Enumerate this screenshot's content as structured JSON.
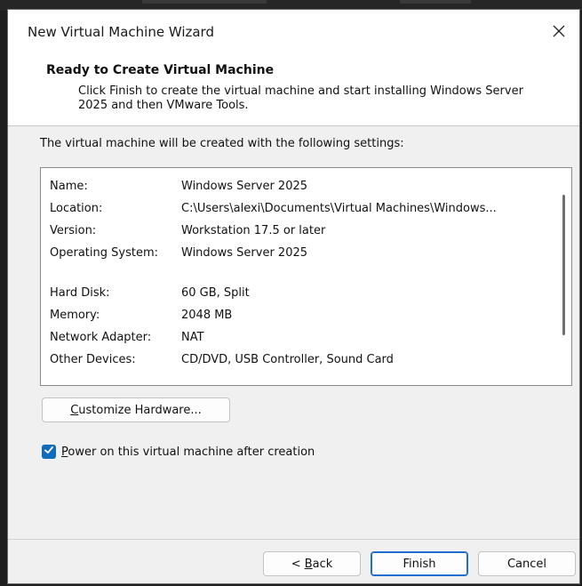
{
  "window": {
    "title": "New Virtual Machine Wizard"
  },
  "header": {
    "title": "Ready to Create Virtual Machine",
    "description": "Click Finish to create the virtual machine and start installing Windows Server 2025 and then VMware Tools."
  },
  "intro": "The virtual machine will be created with the following settings:",
  "settings": [
    {
      "key": "Name:",
      "value": "Windows Server 2025"
    },
    {
      "key": "Location:",
      "value": "C:\\Users\\alexi\\Documents\\Virtual Machines\\Windows..."
    },
    {
      "key": "Version:",
      "value": "Workstation 17.5 or later"
    },
    {
      "key": "Operating System:",
      "value": "Windows Server 2025"
    },
    {
      "key": "Hard Disk:",
      "value": "60 GB, Split"
    },
    {
      "key": "Memory:",
      "value": "2048 MB"
    },
    {
      "key": "Network Adapter:",
      "value": "NAT"
    },
    {
      "key": "Other Devices:",
      "value": "CD/DVD, USB Controller, Sound Card"
    }
  ],
  "customize_button": {
    "underline": "C",
    "rest": "ustomize Hardware..."
  },
  "power_on_checkbox": {
    "checked": true,
    "underline": "P",
    "rest": "ower on this virtual machine after creation"
  },
  "buttons": {
    "back": {
      "prefix": "< ",
      "underline": "B",
      "rest": "ack"
    },
    "finish": "Finish",
    "cancel": "Cancel"
  },
  "colors": {
    "checkbox_accent": "#0f6cbd",
    "default_button_border": "#1f6fd1"
  },
  "icons": {
    "close": "close-icon",
    "check": "checkmark-icon"
  }
}
